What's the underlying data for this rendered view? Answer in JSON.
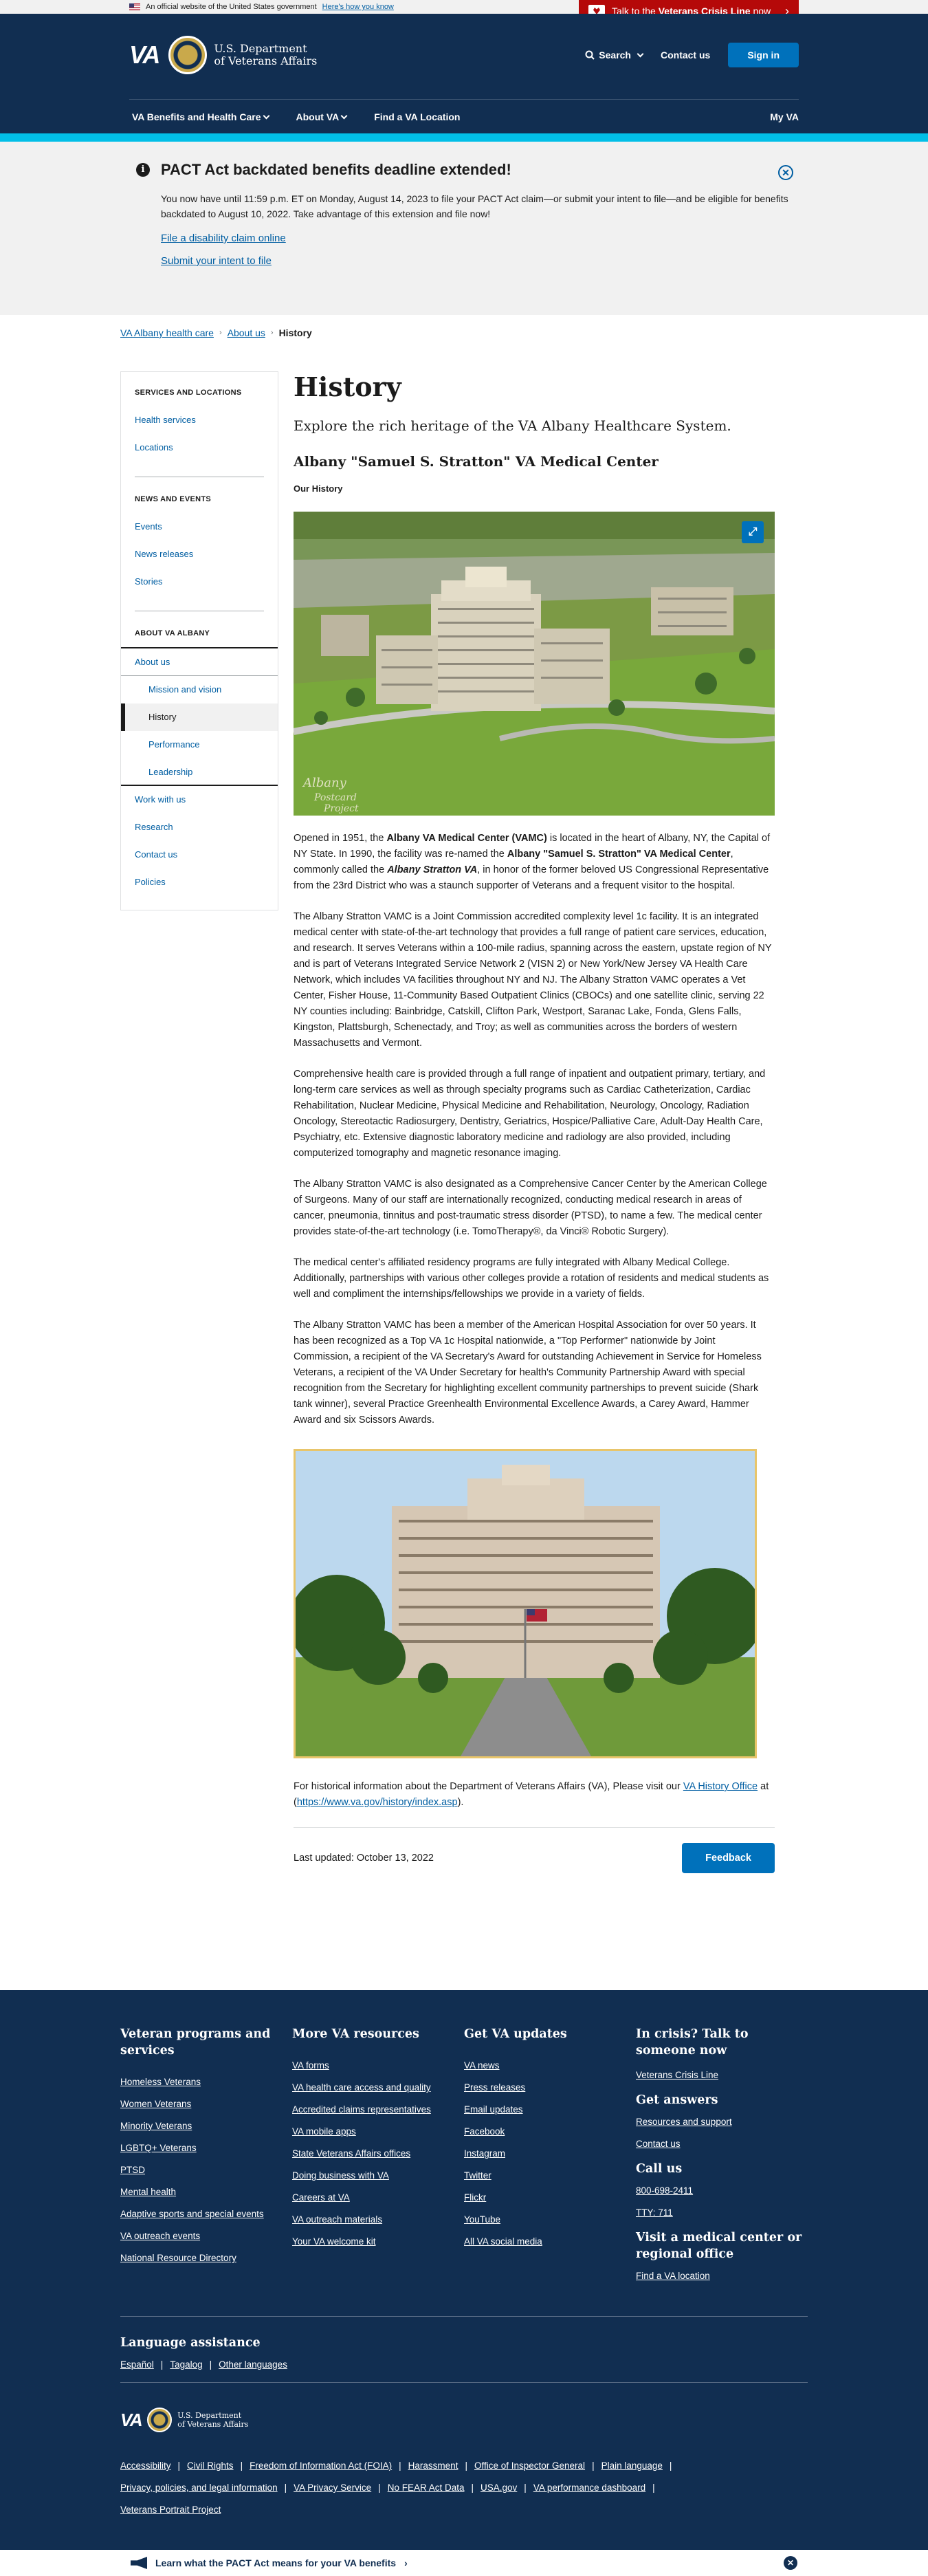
{
  "gov_banner": {
    "text": "An official website of the United States government",
    "link": "Here's how you know"
  },
  "crisis": {
    "prefix": "Talk to the",
    "bold": "Veterans Crisis Line",
    "suffix": "now"
  },
  "header": {
    "logo": "VA",
    "dept_line1": "U.S. Department",
    "dept_line2": "of Veterans Affairs",
    "search": "Search",
    "contact": "Contact us",
    "signin": "Sign in"
  },
  "nav": {
    "items": [
      "VA Benefits and Health Care",
      "About VA",
      "Find a VA Location"
    ],
    "myva": "My VA"
  },
  "alert": {
    "title": "PACT Act backdated benefits deadline extended!",
    "body": "You now have until 11:59 p.m. ET on Monday, August 14, 2023 to file your PACT Act claim—or submit your intent to file—and be eligible for benefits backdated to August 10, 2022. Take advantage of this extension and file now!",
    "link1": "File a disability claim online",
    "link2": "Submit your intent to file"
  },
  "breadcrumb": [
    "VA Albany health care",
    "About us",
    "History"
  ],
  "sidebar": {
    "sec1_title": "SERVICES AND LOCATIONS",
    "sec1": [
      "Health services",
      "Locations"
    ],
    "sec2_title": "NEWS AND EVENTS",
    "sec2": [
      "Events",
      "News releases",
      "Stories"
    ],
    "sec3_title": "ABOUT VA ALBANY",
    "about_us": "About us",
    "about_sub": [
      "Mission and vision",
      "History",
      "Performance",
      "Leadership"
    ],
    "sec3_rest": [
      "Work with us",
      "Research",
      "Contact us",
      "Policies"
    ]
  },
  "main": {
    "title": "History",
    "lead": "Explore the rich heritage of the VA Albany Healthcare System.",
    "h2": "Albany \"Samuel S. Stratton\" VA Medical Center",
    "h3": "Our History",
    "image_caption_mark": "Albany Postcard Project",
    "p1": "Opened in 1951, the Albany VA Medical Center (VAMC) is located in the heart of Albany, NY, the Capital of NY State. In 1990, the facility was re-named the Albany \"Samuel S. Stratton\" VA Medical Center, commonly called the Albany Stratton VA, in honor of the former beloved US Congressional Representative from the 23rd District who was a staunch supporter of Veterans and a frequent visitor to the hospital.",
    "p2": "The Albany Stratton VAMC is a Joint Commission accredited complexity level 1c facility. It is an integrated medical center with state-of-the-art technology that provides a full range of patient care services, education, and research.  It serves Veterans within a 100-mile radius, spanning across the eastern, upstate region of NY and is part of Veterans Integrated Service Network 2 (VISN 2) or New York/New Jersey VA Health Care Network, which includes VA facilities throughout NY and NJ. The Albany Stratton VAMC operates a Vet Center, Fisher House, 11-Community Based Outpatient Clinics (CBOCs) and one satellite clinic, serving 22 NY counties including: Bainbridge, Catskill, Clifton Park, Westport, Saranac Lake, Fonda, Glens Falls, Kingston, Plattsburgh, Schenectady, and Troy; as well as communities across the borders of western Massachusetts and Vermont.",
    "p3": "Comprehensive health care is provided through a full range of inpatient and outpatient primary, tertiary, and long-term care services as well as through specialty programs such as Cardiac Catheterization, Cardiac Rehabilitation, Nuclear Medicine, Physical Medicine and Rehabilitation, Neurology, Oncology, Radiation Oncology, Stereotactic Radiosurgery, Dentistry, Geriatrics, Hospice/Palliative Care, Adult-Day Health Care, Psychiatry, etc. Extensive diagnostic laboratory medicine and radiology are also provided, including computerized tomography and magnetic resonance imaging.",
    "p4": "The Albany Stratton VAMC is also designated as a Comprehensive Cancer Center by the American College of Surgeons. Many of our staff are internationally recognized, conducting medical research in areas of cancer, pneumonia, tinnitus and post-traumatic stress disorder (PTSD), to name a few. The medical center provides state-of-the-art technology (i.e. TomoTherapy®, da Vinci® Robotic Surgery).",
    "p5": "The medical center's affiliated residency programs are fully integrated with Albany Medical College. Additionally, partnerships with various other colleges provide a rotation of residents and medical students as well and compliment the internships/fellowships we provide in a variety of fields.",
    "p6": "The Albany Stratton VAMC has been a member of the American Hospital Association for over 50 years. It has been recognized as a Top VA 1c Hospital nationwide, a \"Top Performer\" nationwide by Joint Commission, a recipient of the VA Secretary's Award for outstanding Achievement in Service for Homeless Veterans, a recipient of the VA Under Secretary for health's Community Partnership Award with special recognition from the Secretary for highlighting excellent community partnerships to prevent suicide (Shark tank winner), several Practice Greenhealth Environmental Excellence Awards, a Carey Award, Hammer Award and six Scissors Awards.",
    "hist_prefix": "For historical information about the Department of Veterans Affairs (VA), Please visit our",
    "hist_link": "VA History Office",
    "hist_mid": "at (",
    "hist_url": "https://www.va.gov/history/index.asp",
    "hist_end": ").",
    "updated": "Last updated: October 13, 2022",
    "feedback": "Feedback"
  },
  "footer": {
    "col1_title": "Veteran programs and services",
    "col1": [
      "Homeless Veterans",
      "Women Veterans",
      "Minority Veterans",
      "LGBTQ+ Veterans",
      "PTSD",
      "Mental health",
      "Adaptive sports and special events",
      "VA outreach events",
      "National Resource Directory"
    ],
    "col2_title": "More VA resources",
    "col2": [
      "VA forms",
      "VA health care access and quality",
      "Accredited claims representatives",
      "VA mobile apps",
      "State Veterans Affairs offices",
      "Doing business with VA",
      "Careers at VA",
      "VA outreach materials",
      "Your VA welcome kit"
    ],
    "col3_title": "Get VA updates",
    "col3": [
      "VA news",
      "Press releases",
      "Email updates",
      "Facebook",
      "Instagram",
      "Twitter",
      "Flickr",
      "YouTube",
      "All VA social media"
    ],
    "col4_title": "In crisis? Talk to someone now",
    "col4_crisis": "Veterans Crisis Line",
    "col4_answers_title": "Get answers",
    "col4_answers": [
      "Resources and support",
      "Contact us"
    ],
    "col4_call_title": "Call us",
    "col4_call": [
      "800-698-2411",
      "TTY: 711"
    ],
    "col4_visit_title": "Visit a medical center or regional office",
    "col4_visit": "Find a VA location",
    "lang_title": "Language assistance",
    "langs": [
      "Español",
      "Tagalog",
      "Other languages"
    ],
    "logo_line1": "U.S. Department",
    "logo_line2": "of Veterans Affairs",
    "legal": [
      "Accessibility",
      "Civil Rights",
      "Freedom of Information Act (FOIA)",
      "Harassment",
      "Office of Inspector General",
      "Plain language",
      "Privacy, policies, and legal information",
      "VA Privacy Service",
      "No FEAR Act Data",
      "USA.gov",
      "VA performance dashboard",
      "Veterans Portrait Project"
    ]
  },
  "pact_banner": {
    "text": "Learn what the PACT Act means for your VA benefits"
  },
  "colors": {
    "navy": "#112e51",
    "link": "#005ea2",
    "button": "#0071bb",
    "crisis": "#b50909",
    "accent": "#02bfe7"
  }
}
